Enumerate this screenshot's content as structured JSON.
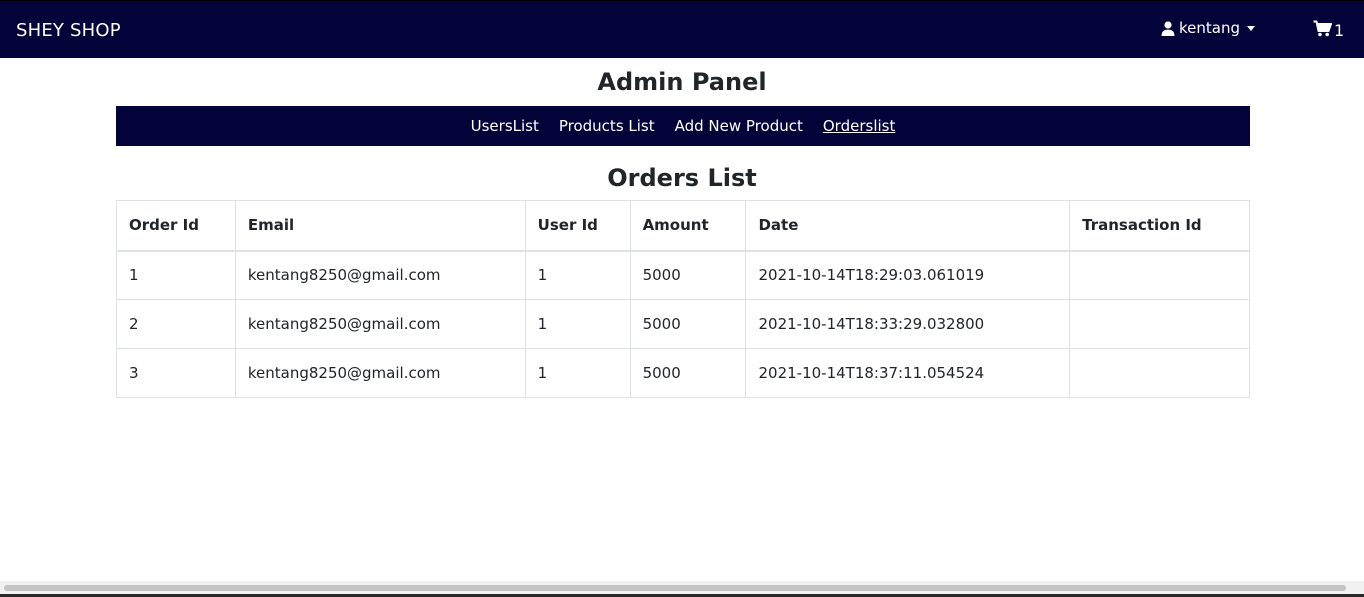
{
  "navbar": {
    "brand": "SHEY SHOP",
    "username": "kentang",
    "cart_count": "1",
    "user_icon": "user-icon",
    "cart_icon": "cart-icon"
  },
  "admin": {
    "title": "Admin Panel",
    "nav": [
      {
        "label": "UsersList"
      },
      {
        "label": "Products List"
      },
      {
        "label": "Add New Product"
      },
      {
        "label": "Orderslist"
      }
    ]
  },
  "orders": {
    "title": "Orders List",
    "headers": [
      "Order Id",
      "Email",
      "User Id",
      "Amount",
      "Date",
      "Transaction Id"
    ],
    "rows": [
      [
        "1",
        "kentang8250@gmail.com",
        "1",
        "5000",
        "2021-10-14T18:29:03.061019",
        ""
      ],
      [
        "2",
        "kentang8250@gmail.com",
        "1",
        "5000",
        "2021-10-14T18:33:29.032800",
        ""
      ],
      [
        "3",
        "kentang8250@gmail.com",
        "1",
        "5000",
        "2021-10-14T18:37:11.054524",
        ""
      ]
    ]
  },
  "colors": {
    "navbar_bg": "#03033a",
    "text": "#212529",
    "border": "#dee2e6"
  }
}
